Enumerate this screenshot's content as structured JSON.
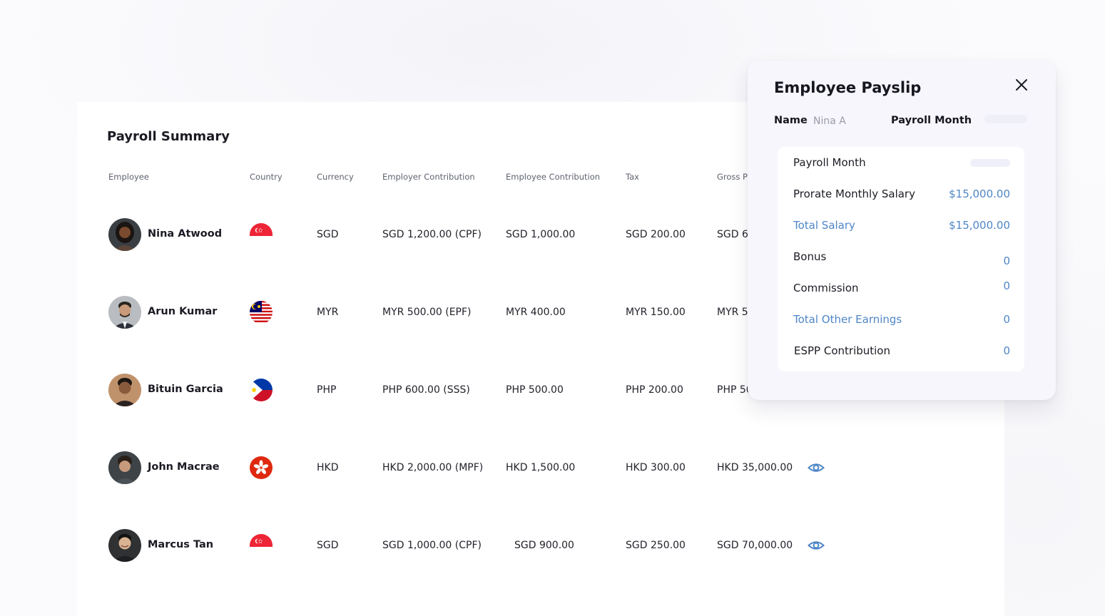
{
  "summary": {
    "title": "Payroll Summary",
    "headers": {
      "employee": "Employee",
      "country": "Country",
      "currency": "Currency",
      "employer_contribution": "Employer Contribution",
      "employee_contribution": "Employee Contribution",
      "tax": "Tax",
      "gross": "Gross P"
    },
    "rows": [
      {
        "name": "Nina Atwood",
        "flag": "singapore-flag",
        "currency": "SGD",
        "employer": "SGD 1,200.00 (CPF)",
        "employee": "SGD 1,000.00",
        "tax": "SGD 200.00",
        "gross": "SGD 6",
        "eye": false
      },
      {
        "name": "Arun Kumar",
        "flag": "malaysia-flag",
        "currency": "MYR",
        "employer": "MYR 500.00 (EPF)",
        "employee": "MYR 400.00",
        "tax": "MYR 150.00",
        "gross": "MYR 5",
        "eye": false
      },
      {
        "name": "Bituin Garcia",
        "flag": "philippines-flag",
        "currency": "PHP",
        "employer": "PHP 600.00 (SSS)",
        "employee": "PHP 500.00",
        "tax": "PHP 200.00",
        "gross": "PHP 50",
        "eye": false
      },
      {
        "name": "John Macrae",
        "flag": "hong-kong-flag",
        "currency": "HKD",
        "employer": "HKD 2,000.00 (MPF)",
        "employee": "HKD 1,500.00",
        "tax": "HKD 300.00",
        "gross": "HKD 35,000.00",
        "eye": true
      },
      {
        "name": "Marcus Tan",
        "flag": "singapore-flag",
        "currency": "SGD",
        "employer": "SGD 1,000.00 (CPF)",
        "employee": "SGD 900.00",
        "tax": "SGD 250.00",
        "gross": "SGD 70,000.00",
        "eye": true
      }
    ]
  },
  "payslip": {
    "title": "Employee Payslip",
    "name_label": "Name",
    "name_value": "Nina A",
    "month_label": "Payroll Month",
    "lines": [
      {
        "label": "Payroll Month",
        "value": "",
        "accent": false
      },
      {
        "label": "Prorate Monthly Salary",
        "value": "$15,000.00",
        "accent": false
      },
      {
        "label": "Total Salary",
        "value": "$15,000.00",
        "accent": true
      },
      {
        "label": "Bonus",
        "value": "0",
        "accent": false
      },
      {
        "label": "Commission",
        "value": "0",
        "accent": false
      },
      {
        "label": "Total Other Earnings",
        "value": "0",
        "accent": true
      },
      {
        "label": "ESPP Contribution",
        "value": "0",
        "accent": false
      }
    ]
  },
  "colors": {
    "accent": "#4f86c6",
    "singapore_red": "#ee2536",
    "hong_kong_red": "#de2910",
    "philippines_blue": "#0038a8",
    "philippines_red": "#ce1126",
    "malaysia_blue": "#010066",
    "malaysia_yellow": "#ffcc00"
  }
}
